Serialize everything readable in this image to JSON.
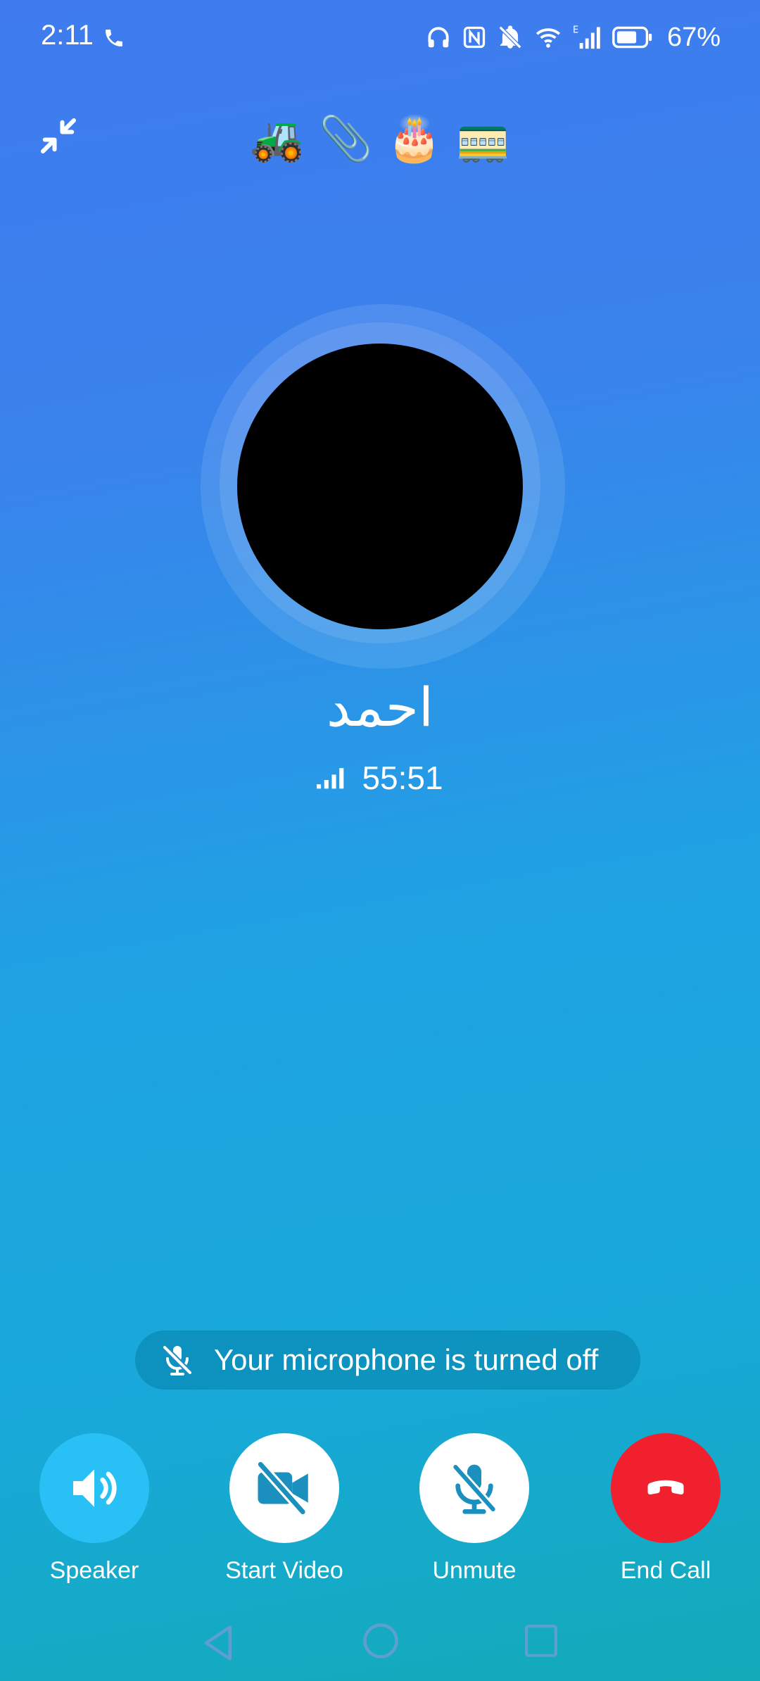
{
  "status_bar": {
    "time": "2:11",
    "battery": "67%",
    "icons": [
      "phone-call-icon",
      "headphones-icon",
      "nfc-icon",
      "silent-bell-icon",
      "wifi-icon",
      "cell-signal-icon",
      "battery-icon"
    ],
    "network_type": "E"
  },
  "header": {
    "minimize_icon": "minimize-arrows-icon",
    "emojis": [
      "🚜",
      "📎",
      "🎂",
      "🚃"
    ]
  },
  "contact": {
    "name": "احمد",
    "call_duration": "55:51",
    "signal_icon": "connection-quality-icon"
  },
  "mic_banner": {
    "icon": "mic-off-icon",
    "text": "Your microphone is turned off"
  },
  "actions": {
    "speaker": {
      "label": "Speaker",
      "icon": "speaker-icon"
    },
    "video": {
      "label": "Start Video",
      "icon": "video-off-icon"
    },
    "unmute": {
      "label": "Unmute",
      "icon": "mic-off-icon"
    },
    "end_call": {
      "label": "End Call",
      "icon": "hang-up-icon"
    }
  },
  "colors": {
    "gradient_top": "#3f7bef",
    "gradient_bottom": "#12aab8",
    "speaker_button": "#29c0f5",
    "end_call_button": "#f0202e"
  }
}
